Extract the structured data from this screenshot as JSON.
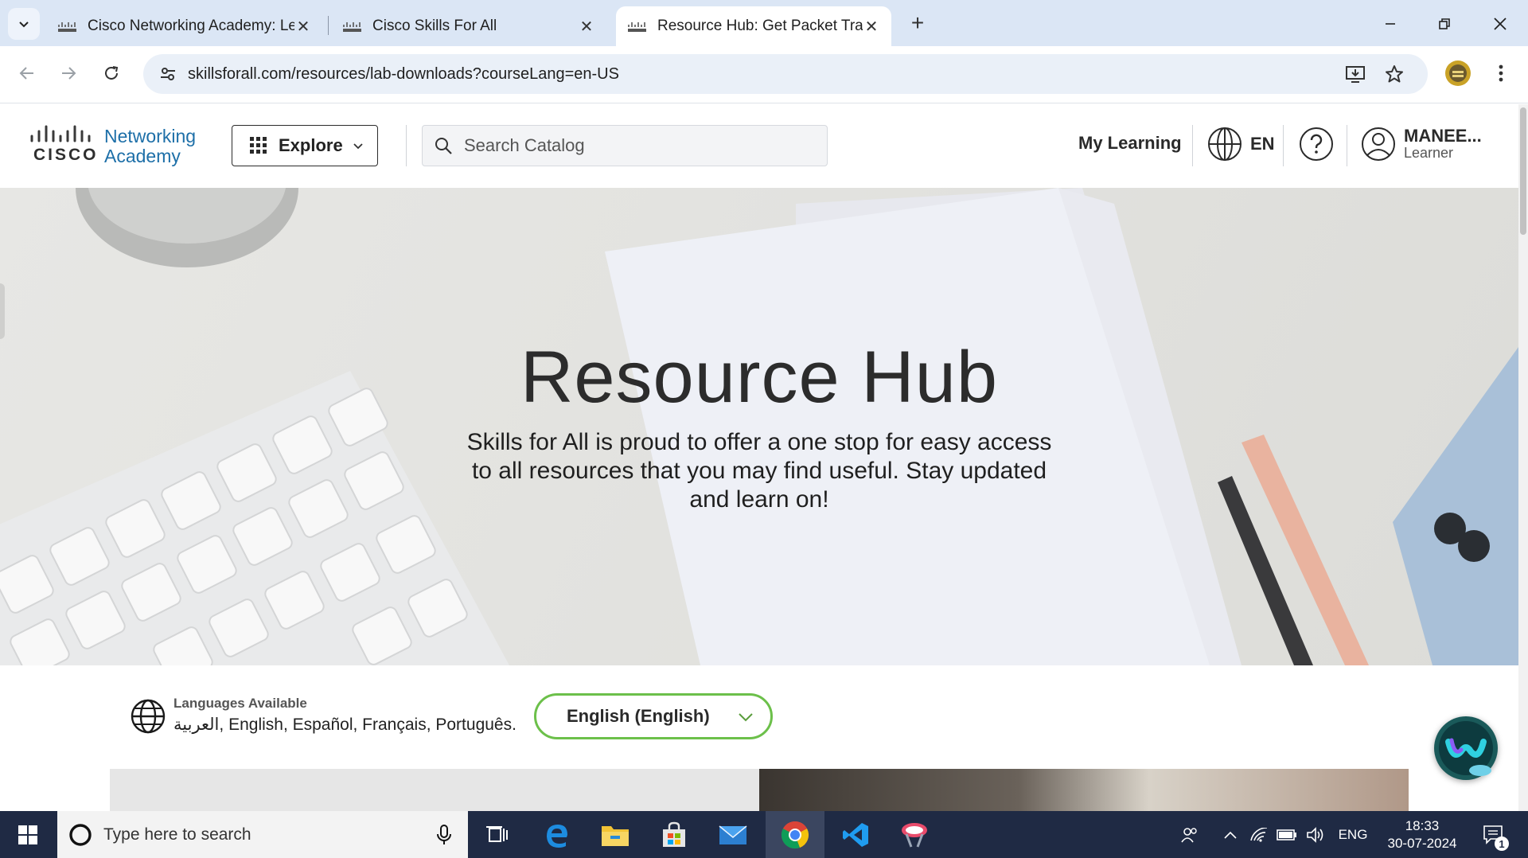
{
  "browser": {
    "tabs": [
      {
        "title": "Cisco Networking Academy: Le",
        "active": false
      },
      {
        "title": "Cisco Skills For All",
        "active": false
      },
      {
        "title": "Resource Hub: Get Packet Trace",
        "active": true
      }
    ],
    "url": "skillsforall.com/resources/lab-downloads?courseLang=en-US"
  },
  "site": {
    "logo": {
      "line1": "Networking",
      "line2": "Academy",
      "wordmark": "CISCO"
    },
    "explore_label": "Explore",
    "search_placeholder": "Search Catalog",
    "my_learning": "My Learning",
    "language_code": "EN",
    "user": {
      "name": "MANEE...",
      "role": "Learner"
    }
  },
  "hero": {
    "title": "Resource Hub",
    "subtitle": "Skills for All is proud to offer a one stop for easy access to all resources that you may find useful. Stay updated and learn on!"
  },
  "languages": {
    "heading": "Languages Available",
    "list": "العربية, English, Español, Français, Português.",
    "selected": "English (English)"
  },
  "taskbar": {
    "search_placeholder": "Type here to search",
    "language": "ENG",
    "time": "18:33",
    "date": "30-07-2024",
    "notification_count": "1"
  },
  "colors": {
    "tabstrip": "#dbe6f5",
    "cisco_blue": "#1d6fa8",
    "select_border": "#6cc04a",
    "taskbar": "#1f2a44"
  },
  "icons": {
    "tab_search": "chevron-down-icon",
    "back": "arrow-left-icon",
    "forward": "arrow-right-icon",
    "reload": "reload-icon",
    "site_info": "tune-icon",
    "install": "install-icon",
    "bookmark": "star-icon",
    "menu": "kebab-icon"
  }
}
